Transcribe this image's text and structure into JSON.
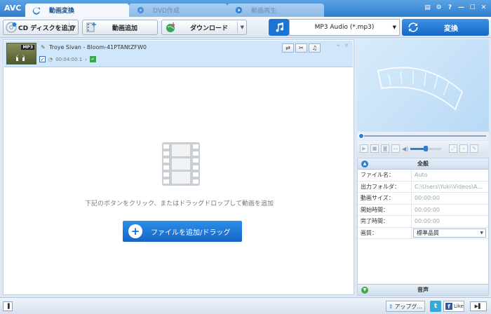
{
  "app": {
    "logo": "AVC",
    "tabs": [
      {
        "label": "動画変換",
        "active": true
      },
      {
        "label": "DVD作成",
        "active": false
      },
      {
        "label": "動画再生",
        "active": false
      }
    ]
  },
  "toolbar": {
    "cd_label": "CD ディスクを追加",
    "add_video_label": "動画追加",
    "download_label": "ダウンロード",
    "format_value": "MP3 Audio (*.mp3)",
    "convert_label": "変換"
  },
  "file_item": {
    "badge": "MP3",
    "name": "Troye Sivan - Bloom-41PTANtZFW0",
    "duration": "00:04:00.1",
    "checked": true
  },
  "empty": {
    "hint": "下記のボタンをクリック、またはドラッグドロップして動画を追加",
    "add_button": "ファイルを追加/ドラッグ"
  },
  "preview": {
    "seek": 0.0,
    "volume": 0.5
  },
  "properties": {
    "header": "全般",
    "rows": [
      {
        "label": "ファイル名：",
        "value": "Auto"
      },
      {
        "label": "出力フォルダ：",
        "value": "C:\\Users\\Yuki\\Videos\\A..."
      },
      {
        "label": "動画サイズ：",
        "value": "00:00:00"
      },
      {
        "label": "開始時間：",
        "value": "00:00:00"
      },
      {
        "label": "完了時間：",
        "value": "00:00:00"
      },
      {
        "label": "画質：",
        "value": "標準品質"
      }
    ],
    "footer": "音声"
  },
  "status": {
    "upgrade_label": "アップグ...",
    "fb_label": "Like",
    "twitter_letter": "t",
    "fb_letter": "f"
  },
  "colors": {
    "accent": "#1b73d3",
    "selected_row": "#cfe6fb"
  }
}
